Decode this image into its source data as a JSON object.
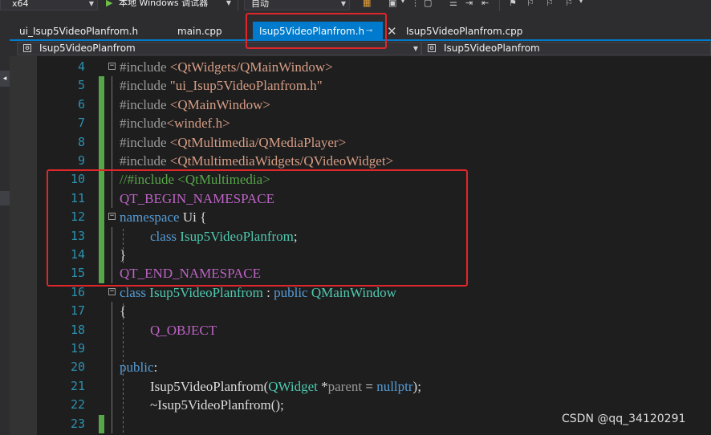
{
  "toolbar": {
    "platform": "x64",
    "debugger": "本地 Windows 调试器",
    "config": "自动"
  },
  "tabs": [
    {
      "label": "ui_Isup5VideoPlanfrom.h"
    },
    {
      "label": "main.cpp"
    },
    {
      "label": "Isup5VideoPlanfrom.h",
      "active": true
    },
    {
      "label": "Isup5VideoPlanfrom.cpp"
    }
  ],
  "nav": {
    "scope": "Isup5VideoPlanfrom",
    "member": "Isup5VideoPlanfrom"
  },
  "code_lines": [
    {
      "n": "4",
      "parts": [
        {
          "c": "pp",
          "t": "#include "
        },
        {
          "c": "str",
          "t": "<QtWidgets/QMainWindow>"
        }
      ]
    },
    {
      "n": "5",
      "parts": [
        {
          "c": "pp",
          "t": "#include "
        },
        {
          "c": "str",
          "t": "\"ui_Isup5VideoPlanfrom.h\""
        }
      ]
    },
    {
      "n": "6",
      "parts": [
        {
          "c": "pp",
          "t": "#include "
        },
        {
          "c": "str",
          "t": "<QMainWindow>"
        }
      ]
    },
    {
      "n": "7",
      "parts": [
        {
          "c": "pp",
          "t": "#include"
        },
        {
          "c": "str",
          "t": "<windef.h>"
        }
      ]
    },
    {
      "n": "8",
      "parts": [
        {
          "c": "pp",
          "t": "#include "
        },
        {
          "c": "str",
          "t": "<QtMultimedia/QMediaPlayer>"
        }
      ]
    },
    {
      "n": "9",
      "parts": [
        {
          "c": "pp",
          "t": "#include "
        },
        {
          "c": "str",
          "t": "<QtMultimediaWidgets/QVideoWidget>"
        }
      ]
    },
    {
      "n": "10",
      "parts": [
        {
          "c": "cm",
          "t": "//#include <QtMultimedia>"
        }
      ]
    },
    {
      "n": "11",
      "parts": [
        {
          "c": "mac",
          "t": "QT_BEGIN_NAMESPACE"
        }
      ]
    },
    {
      "n": "12",
      "parts": [
        {
          "c": "kw",
          "t": "namespace"
        },
        {
          "c": "pl",
          "t": " Ui {"
        }
      ]
    },
    {
      "n": "13",
      "parts": [
        {
          "c": "kw",
          "t": "class"
        },
        {
          "c": "pl",
          "t": " "
        },
        {
          "c": "ty",
          "t": "Isup5VideoPlanfrom"
        },
        {
          "c": "pl",
          "t": ";"
        }
      ]
    },
    {
      "n": "14",
      "parts": [
        {
          "c": "pl",
          "t": "}"
        }
      ]
    },
    {
      "n": "15",
      "parts": [
        {
          "c": "mac",
          "t": "QT_END_NAMESPACE"
        }
      ]
    },
    {
      "n": "16",
      "parts": [
        {
          "c": "kw",
          "t": "class"
        },
        {
          "c": "pl",
          "t": " "
        },
        {
          "c": "ty",
          "t": "Isup5VideoPlanfrom"
        },
        {
          "c": "pl",
          "t": " : "
        },
        {
          "c": "kw",
          "t": "public"
        },
        {
          "c": "pl",
          "t": " "
        },
        {
          "c": "ty",
          "t": "QMainWindow"
        }
      ]
    },
    {
      "n": "17",
      "parts": [
        {
          "c": "pl",
          "t": "{"
        }
      ]
    },
    {
      "n": "18",
      "parts": [
        {
          "c": "mac",
          "t": "Q_OBJECT"
        }
      ]
    },
    {
      "n": "19",
      "parts": []
    },
    {
      "n": "20",
      "parts": [
        {
          "c": "kw",
          "t": "public"
        },
        {
          "c": "pl",
          "t": ":"
        }
      ]
    },
    {
      "n": "21",
      "parts": [
        {
          "c": "pl",
          "t": "Isup5VideoPlanfrom("
        },
        {
          "c": "ty",
          "t": "QWidget"
        },
        {
          "c": "pl",
          "t": " *"
        },
        {
          "c": "param",
          "t": "parent"
        },
        {
          "c": "pl",
          "t": " = "
        },
        {
          "c": "kw",
          "t": "nullptr"
        },
        {
          "c": "pl",
          "t": ");"
        }
      ]
    },
    {
      "n": "22",
      "parts": [
        {
          "c": "pl",
          "t": "~Isup5VideoPlanfrom();"
        }
      ]
    },
    {
      "n": "23",
      "parts": []
    }
  ],
  "watermark": "CSDN @qq_34120291"
}
